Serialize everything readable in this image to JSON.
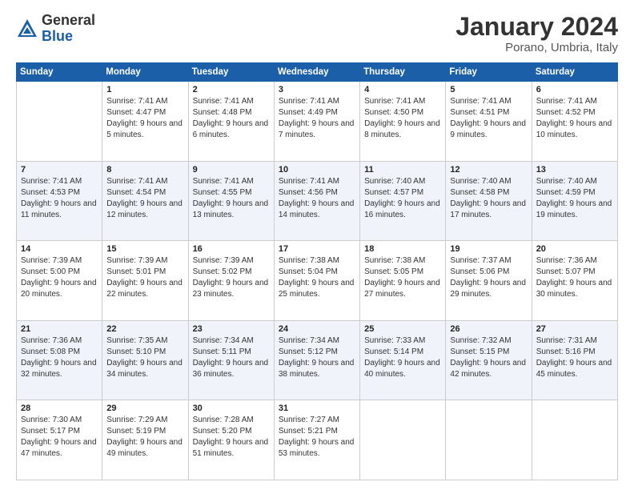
{
  "header": {
    "logo_general": "General",
    "logo_blue": "Blue",
    "title": "January 2024",
    "subtitle": "Porano, Umbria, Italy"
  },
  "calendar": {
    "days_of_week": [
      "Sunday",
      "Monday",
      "Tuesday",
      "Wednesday",
      "Thursday",
      "Friday",
      "Saturday"
    ],
    "weeks": [
      [
        {
          "day": "",
          "info": ""
        },
        {
          "day": "1",
          "sunrise": "Sunrise: 7:41 AM",
          "sunset": "Sunset: 4:47 PM",
          "daylight": "Daylight: 9 hours and 5 minutes."
        },
        {
          "day": "2",
          "sunrise": "Sunrise: 7:41 AM",
          "sunset": "Sunset: 4:48 PM",
          "daylight": "Daylight: 9 hours and 6 minutes."
        },
        {
          "day": "3",
          "sunrise": "Sunrise: 7:41 AM",
          "sunset": "Sunset: 4:49 PM",
          "daylight": "Daylight: 9 hours and 7 minutes."
        },
        {
          "day": "4",
          "sunrise": "Sunrise: 7:41 AM",
          "sunset": "Sunset: 4:50 PM",
          "daylight": "Daylight: 9 hours and 8 minutes."
        },
        {
          "day": "5",
          "sunrise": "Sunrise: 7:41 AM",
          "sunset": "Sunset: 4:51 PM",
          "daylight": "Daylight: 9 hours and 9 minutes."
        },
        {
          "day": "6",
          "sunrise": "Sunrise: 7:41 AM",
          "sunset": "Sunset: 4:52 PM",
          "daylight": "Daylight: 9 hours and 10 minutes."
        }
      ],
      [
        {
          "day": "7",
          "sunrise": "Sunrise: 7:41 AM",
          "sunset": "Sunset: 4:53 PM",
          "daylight": "Daylight: 9 hours and 11 minutes."
        },
        {
          "day": "8",
          "sunrise": "Sunrise: 7:41 AM",
          "sunset": "Sunset: 4:54 PM",
          "daylight": "Daylight: 9 hours and 12 minutes."
        },
        {
          "day": "9",
          "sunrise": "Sunrise: 7:41 AM",
          "sunset": "Sunset: 4:55 PM",
          "daylight": "Daylight: 9 hours and 13 minutes."
        },
        {
          "day": "10",
          "sunrise": "Sunrise: 7:41 AM",
          "sunset": "Sunset: 4:56 PM",
          "daylight": "Daylight: 9 hours and 14 minutes."
        },
        {
          "day": "11",
          "sunrise": "Sunrise: 7:40 AM",
          "sunset": "Sunset: 4:57 PM",
          "daylight": "Daylight: 9 hours and 16 minutes."
        },
        {
          "day": "12",
          "sunrise": "Sunrise: 7:40 AM",
          "sunset": "Sunset: 4:58 PM",
          "daylight": "Daylight: 9 hours and 17 minutes."
        },
        {
          "day": "13",
          "sunrise": "Sunrise: 7:40 AM",
          "sunset": "Sunset: 4:59 PM",
          "daylight": "Daylight: 9 hours and 19 minutes."
        }
      ],
      [
        {
          "day": "14",
          "sunrise": "Sunrise: 7:39 AM",
          "sunset": "Sunset: 5:00 PM",
          "daylight": "Daylight: 9 hours and 20 minutes."
        },
        {
          "day": "15",
          "sunrise": "Sunrise: 7:39 AM",
          "sunset": "Sunset: 5:01 PM",
          "daylight": "Daylight: 9 hours and 22 minutes."
        },
        {
          "day": "16",
          "sunrise": "Sunrise: 7:39 AM",
          "sunset": "Sunset: 5:02 PM",
          "daylight": "Daylight: 9 hours and 23 minutes."
        },
        {
          "day": "17",
          "sunrise": "Sunrise: 7:38 AM",
          "sunset": "Sunset: 5:04 PM",
          "daylight": "Daylight: 9 hours and 25 minutes."
        },
        {
          "day": "18",
          "sunrise": "Sunrise: 7:38 AM",
          "sunset": "Sunset: 5:05 PM",
          "daylight": "Daylight: 9 hours and 27 minutes."
        },
        {
          "day": "19",
          "sunrise": "Sunrise: 7:37 AM",
          "sunset": "Sunset: 5:06 PM",
          "daylight": "Daylight: 9 hours and 29 minutes."
        },
        {
          "day": "20",
          "sunrise": "Sunrise: 7:36 AM",
          "sunset": "Sunset: 5:07 PM",
          "daylight": "Daylight: 9 hours and 30 minutes."
        }
      ],
      [
        {
          "day": "21",
          "sunrise": "Sunrise: 7:36 AM",
          "sunset": "Sunset: 5:08 PM",
          "daylight": "Daylight: 9 hours and 32 minutes."
        },
        {
          "day": "22",
          "sunrise": "Sunrise: 7:35 AM",
          "sunset": "Sunset: 5:10 PM",
          "daylight": "Daylight: 9 hours and 34 minutes."
        },
        {
          "day": "23",
          "sunrise": "Sunrise: 7:34 AM",
          "sunset": "Sunset: 5:11 PM",
          "daylight": "Daylight: 9 hours and 36 minutes."
        },
        {
          "day": "24",
          "sunrise": "Sunrise: 7:34 AM",
          "sunset": "Sunset: 5:12 PM",
          "daylight": "Daylight: 9 hours and 38 minutes."
        },
        {
          "day": "25",
          "sunrise": "Sunrise: 7:33 AM",
          "sunset": "Sunset: 5:14 PM",
          "daylight": "Daylight: 9 hours and 40 minutes."
        },
        {
          "day": "26",
          "sunrise": "Sunrise: 7:32 AM",
          "sunset": "Sunset: 5:15 PM",
          "daylight": "Daylight: 9 hours and 42 minutes."
        },
        {
          "day": "27",
          "sunrise": "Sunrise: 7:31 AM",
          "sunset": "Sunset: 5:16 PM",
          "daylight": "Daylight: 9 hours and 45 minutes."
        }
      ],
      [
        {
          "day": "28",
          "sunrise": "Sunrise: 7:30 AM",
          "sunset": "Sunset: 5:17 PM",
          "daylight": "Daylight: 9 hours and 47 minutes."
        },
        {
          "day": "29",
          "sunrise": "Sunrise: 7:29 AM",
          "sunset": "Sunset: 5:19 PM",
          "daylight": "Daylight: 9 hours and 49 minutes."
        },
        {
          "day": "30",
          "sunrise": "Sunrise: 7:28 AM",
          "sunset": "Sunset: 5:20 PM",
          "daylight": "Daylight: 9 hours and 51 minutes."
        },
        {
          "day": "31",
          "sunrise": "Sunrise: 7:27 AM",
          "sunset": "Sunset: 5:21 PM",
          "daylight": "Daylight: 9 hours and 53 minutes."
        },
        {
          "day": "",
          "info": ""
        },
        {
          "day": "",
          "info": ""
        },
        {
          "day": "",
          "info": ""
        }
      ]
    ]
  }
}
